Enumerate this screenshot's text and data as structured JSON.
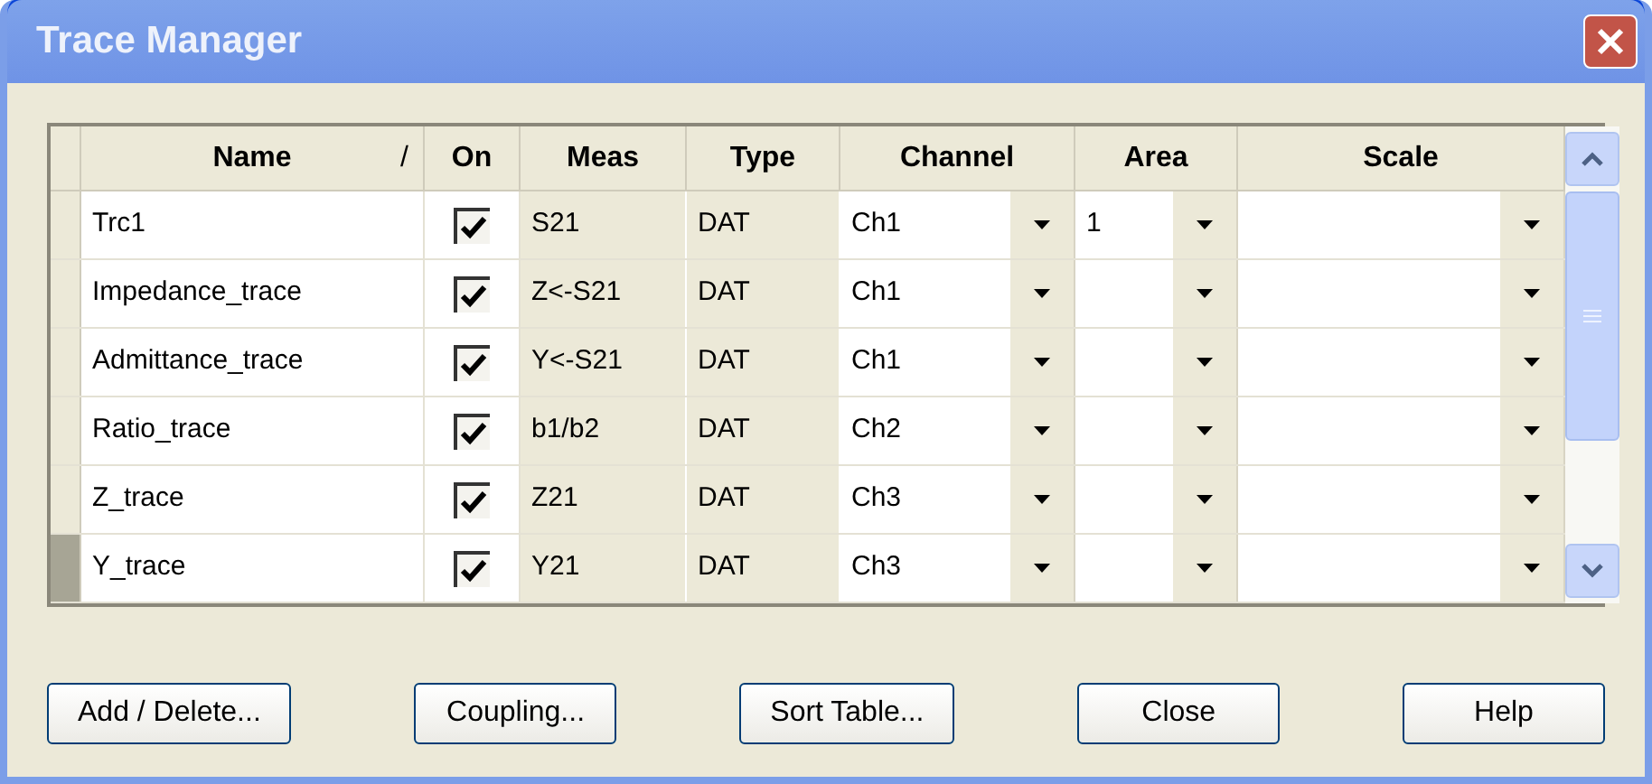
{
  "window": {
    "title": "Trace Manager"
  },
  "table": {
    "columns": [
      {
        "label": "Name",
        "sort_indicator": "/"
      },
      {
        "label": "On"
      },
      {
        "label": "Meas"
      },
      {
        "label": "Type"
      },
      {
        "label": "Channel"
      },
      {
        "label": "Area"
      },
      {
        "label": "Scale"
      }
    ],
    "rows": [
      {
        "selected": false,
        "name": "Trc1",
        "on": true,
        "meas": "S21",
        "type": "DAT",
        "channel": "Ch1",
        "area": "1",
        "scale": ""
      },
      {
        "selected": false,
        "name": "Impedance_trace",
        "on": true,
        "meas": "Z<-S21",
        "type": "DAT",
        "channel": "Ch1",
        "area": "",
        "scale": ""
      },
      {
        "selected": false,
        "name": "Admittance_trace",
        "on": true,
        "meas": "Y<-S21",
        "type": "DAT",
        "channel": "Ch1",
        "area": "",
        "scale": ""
      },
      {
        "selected": false,
        "name": "Ratio_trace",
        "on": true,
        "meas": "b1/b2",
        "type": "DAT",
        "channel": "Ch2",
        "area": "",
        "scale": ""
      },
      {
        "selected": false,
        "name": "Z_trace",
        "on": true,
        "meas": "Z21",
        "type": "DAT",
        "channel": "Ch3",
        "area": "",
        "scale": ""
      },
      {
        "selected": true,
        "name": "Y_trace",
        "on": true,
        "meas": "Y21",
        "type": "DAT",
        "channel": "Ch3",
        "area": "",
        "scale": ""
      }
    ]
  },
  "buttons": [
    "Add / Delete...",
    "Coupling...",
    "Sort Table...",
    "Close",
    "Help"
  ]
}
